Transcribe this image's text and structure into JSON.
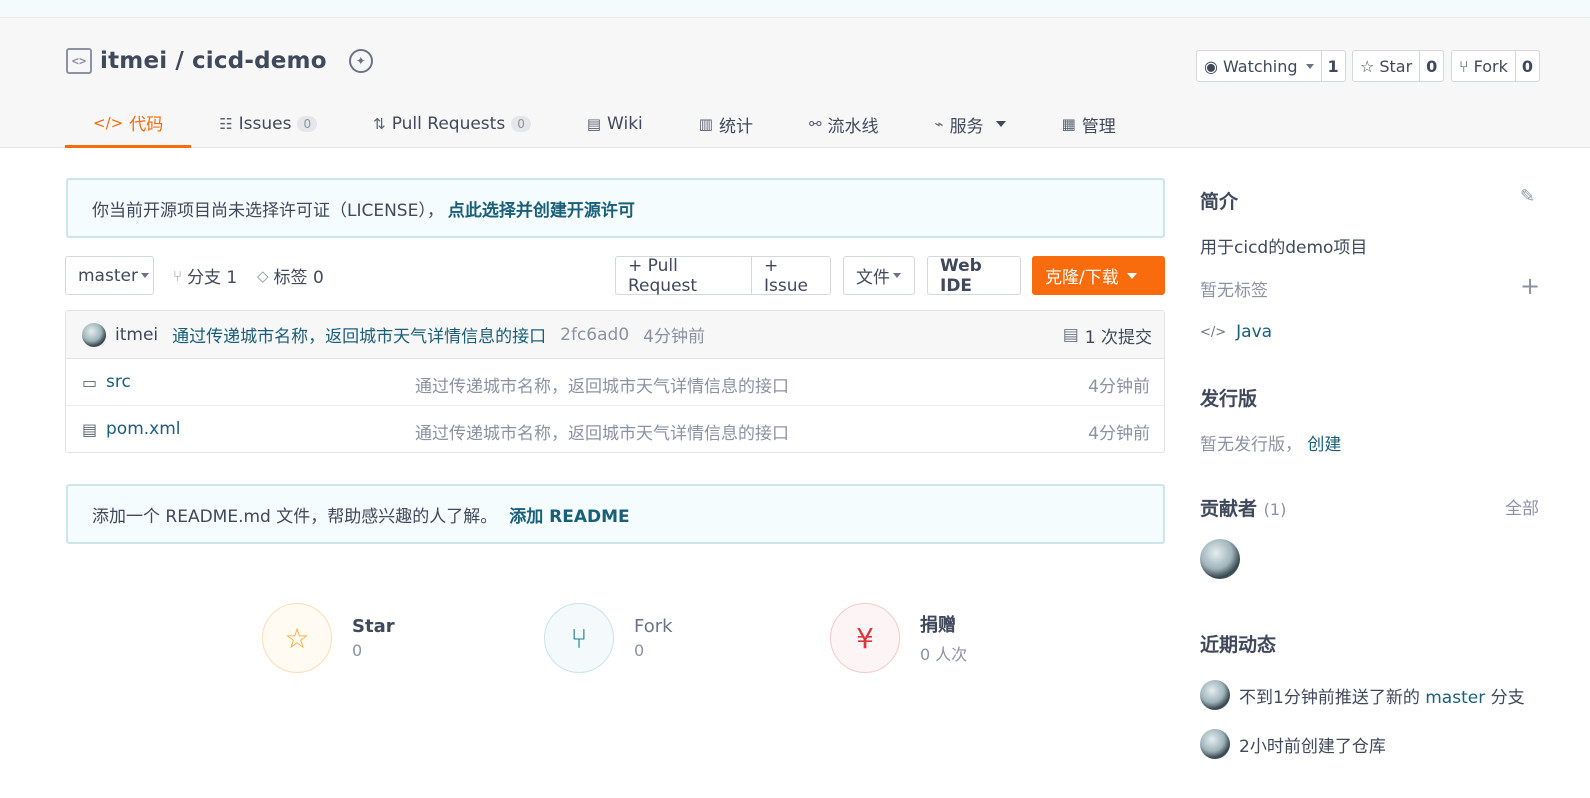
{
  "repo": {
    "owner": "itmei",
    "separator": "/",
    "name": "cicd-demo",
    "watching_label": "Watching",
    "watching_count": "1",
    "star_label": "Star",
    "star_count": "0",
    "fork_label": "Fork",
    "fork_count": "0"
  },
  "tabs": [
    {
      "label": "代码",
      "icon": "code-icon"
    },
    {
      "label": "Issues",
      "count": "0",
      "icon": "issues-icon"
    },
    {
      "label": "Pull Requests",
      "count": "0",
      "icon": "pull-request-icon"
    },
    {
      "label": "Wiki",
      "icon": "book-icon"
    },
    {
      "label": "统计",
      "icon": "bar-chart-icon"
    },
    {
      "label": "流水线",
      "icon": "pipeline-icon"
    },
    {
      "label": "服务",
      "icon": "pulse-icon"
    },
    {
      "label": "管理",
      "icon": "settings-doc-icon"
    }
  ],
  "license_notice": {
    "text": "你当前开源项目尚未选择许可证（LICENSE），",
    "link": "点此选择并创建开源许可"
  },
  "toolbar": {
    "branch": "master",
    "branches_label": "分支 1",
    "tags_label": "标签 0",
    "pull_request_button": "+ Pull Request",
    "issue_button": "+ Issue",
    "file_button": "文件",
    "web_ide_button": "Web IDE",
    "clone_button": "克隆/下载"
  },
  "latest_commit": {
    "author": "itmei",
    "message": "通过传递城市名称，返回城市天气详情信息的接口",
    "sha": "2fc6ad0",
    "time": "4分钟前",
    "count_label": "1 次提交"
  },
  "files": [
    {
      "name": "src",
      "type": "folder",
      "message": "通过传递城市名称，返回城市天气详情信息的接口",
      "time": "4分钟前"
    },
    {
      "name": "pom.xml",
      "type": "file",
      "message": "通过传递城市名称，返回城市天气详情信息的接口",
      "time": "4分钟前"
    }
  ],
  "readme_notice": {
    "text": "添加一个 README.md 文件，帮助感兴趣的人了解。",
    "link": "添加 README"
  },
  "stats": [
    {
      "label": "Star",
      "value": "0",
      "color": "#f5a623"
    },
    {
      "label": "Fork",
      "value": "0",
      "color": "#1a7f8e"
    },
    {
      "label": "捐赠",
      "value": "0 人次",
      "color": "#d9363e"
    }
  ],
  "sidebar": {
    "intro_title": "简介",
    "intro_text": "用于cicd的demo项目",
    "no_tags": "暂无标签",
    "language": "Java",
    "release_title": "发行版",
    "no_release": "暂无发行版，",
    "create_link": "创建",
    "contributors_title": "贡献者",
    "contributors_count": "(1)",
    "contributors_all": "全部",
    "activity_title": "近期动态",
    "activities": [
      {
        "prefix": "不到1分钟前推送了新的",
        "branch": "master",
        "suffix": "分支"
      },
      {
        "text": "2小时前创建了仓库"
      }
    ]
  },
  "colors": {
    "accent": "#f86c0d",
    "link": "#1a5f7a",
    "text": "#40485b",
    "muted": "#8c92a4"
  }
}
